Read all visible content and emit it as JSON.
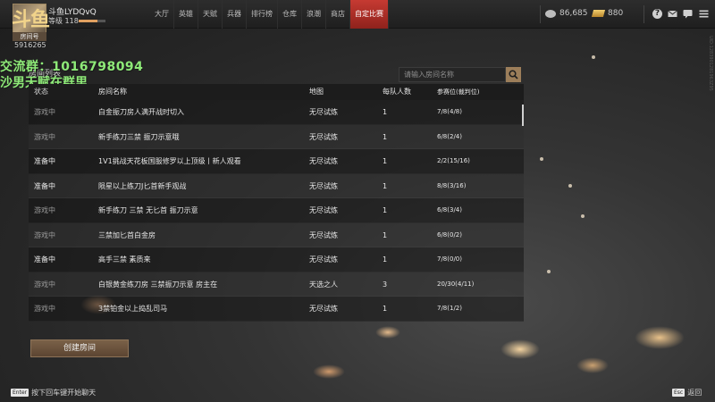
{
  "player": {
    "name": "斗鱼LYDQvQ",
    "level_text": "等级 118",
    "level_progress": 0.7,
    "room_tag": "房间号",
    "room_id": "5916265",
    "logo_text": "斗鱼"
  },
  "nav": {
    "items": [
      "大厅",
      "英雄",
      "天赋",
      "兵器",
      "排行榜",
      "仓库",
      "浪潮",
      "商店",
      "自定比赛"
    ],
    "active_index": 8
  },
  "currency": {
    "coins": "86,685",
    "gold": "880"
  },
  "overlay": {
    "line1": "交流群：1016798094",
    "line2": "沙男天赋在群里"
  },
  "room_list_label": "房间列表",
  "search": {
    "placeholder": "请输入房间名称"
  },
  "table": {
    "headers": {
      "status": "状态",
      "name": "房间名称",
      "map": "地图",
      "team": "每队人数",
      "slots": "参赛位(裁判位)"
    },
    "rows": [
      {
        "status": "游戏中",
        "state": "playing",
        "name": "白金振刀房人满开战时切入",
        "map": "无尽试炼",
        "team": "1",
        "slots": "7/8(4/8)"
      },
      {
        "status": "游戏中",
        "state": "playing",
        "name": "新手练刀三禁 振刀示意哦",
        "map": "无尽试炼",
        "team": "1",
        "slots": "6/8(2/4)"
      },
      {
        "status": "准备中",
        "state": "ready",
        "name": "1V1挑战天花板国服修罗以上顶级丨新人观看",
        "map": "无尽试炼",
        "team": "1",
        "slots": "2/2(15/16)"
      },
      {
        "status": "准备中",
        "state": "ready",
        "name": "陨星以上练刀J匕首新手观战",
        "map": "无尽试炼",
        "team": "1",
        "slots": "8/8(3/16)"
      },
      {
        "status": "游戏中",
        "state": "playing",
        "name": "新手练刀 三禁 无匕首 振刀示意",
        "map": "无尽试炼",
        "team": "1",
        "slots": "6/8(3/4)"
      },
      {
        "status": "游戏中",
        "state": "playing",
        "name": "三禁加匕首白金房",
        "map": "无尽试炼",
        "team": "1",
        "slots": "6/8(0/2)"
      },
      {
        "status": "准备中",
        "state": "ready",
        "name": "高手三禁 素质来",
        "map": "无尽试炼",
        "team": "1",
        "slots": "7/8(0/0)"
      },
      {
        "status": "游戏中",
        "state": "playing",
        "name": "白银黄金练刀房 三禁振刀示意 房主在",
        "map": "天选之人",
        "team": "3",
        "slots": "20/30(4/11)"
      },
      {
        "status": "游戏中",
        "state": "playing",
        "name": "3禁铂金以上捣乱司马",
        "map": "无尽试炼",
        "team": "1",
        "slots": "7/8(1/2)"
      }
    ]
  },
  "create_button": "创建房间",
  "footer": {
    "enter_key": "Enter",
    "enter_hint": "按下回车键开始聊天",
    "esc_key": "Esc",
    "esc_hint": "返回"
  },
  "side_text": "UID:1283901281963Z95",
  "colors": {
    "accent_red": "#c63a32",
    "overlay_green": "#8eea78",
    "gold": "#d9ae5a"
  }
}
